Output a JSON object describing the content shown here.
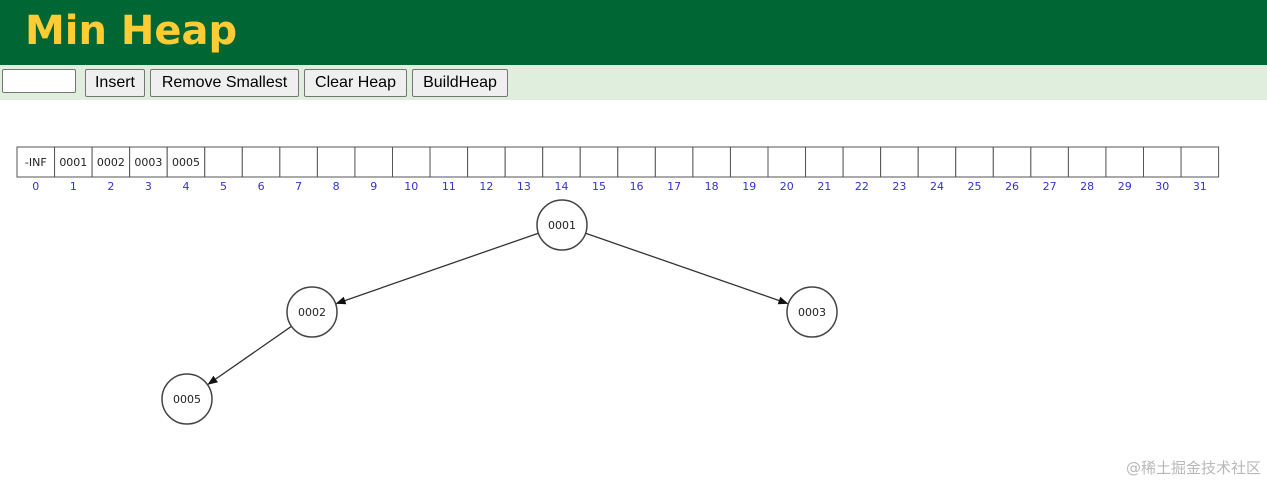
{
  "header": {
    "title": "Min Heap"
  },
  "toolbar": {
    "input_value": "",
    "insert_label": "Insert",
    "remove_label": "Remove Smallest",
    "clear_label": "Clear Heap",
    "build_label": "BuildHeap"
  },
  "heap_array": {
    "cells": [
      "-INF",
      "0001",
      "0002",
      "0003",
      "0005",
      "",
      "",
      "",
      "",
      "",
      "",
      "",
      "",
      "",
      "",
      "",
      "",
      "",
      "",
      "",
      "",
      "",
      "",
      "",
      "",
      "",
      "",
      "",
      "",
      "",
      "",
      ""
    ],
    "indices": [
      "0",
      "1",
      "2",
      "3",
      "4",
      "5",
      "6",
      "7",
      "8",
      "9",
      "10",
      "11",
      "12",
      "13",
      "14",
      "15",
      "16",
      "17",
      "18",
      "19",
      "20",
      "21",
      "22",
      "23",
      "24",
      "25",
      "26",
      "27",
      "28",
      "29",
      "30",
      "31"
    ]
  },
  "tree": {
    "nodes": [
      {
        "id": "n1",
        "label": "0001",
        "index": 1
      },
      {
        "id": "n2",
        "label": "0002",
        "index": 2
      },
      {
        "id": "n3",
        "label": "0003",
        "index": 3
      },
      {
        "id": "n5",
        "label": "0005",
        "index": 4
      }
    ],
    "edges": [
      {
        "from": "n1",
        "to": "n2"
      },
      {
        "from": "n1",
        "to": "n3"
      },
      {
        "from": "n2",
        "to": "n5"
      }
    ]
  },
  "colors": {
    "header_bg": "#006633",
    "title_color": "#FFCC33",
    "toolbar_bg": "#dfeedd",
    "index_color": "#3333cc"
  },
  "watermark": "@稀土掘金技术社区"
}
